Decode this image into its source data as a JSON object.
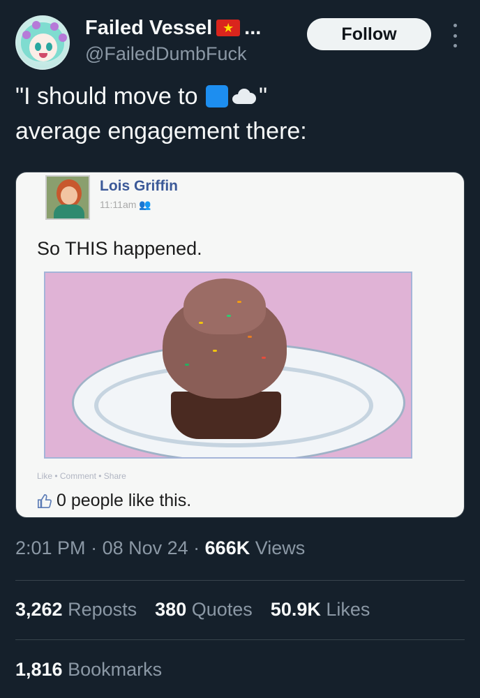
{
  "author": {
    "display_name": "Failed Vessel",
    "flag_icon": "vietnam-flag-icon",
    "truncation": "...",
    "handle": "@FailedDumbFuck"
  },
  "follow_label": "Follow",
  "tweet": {
    "line1_start": "\"I should move to ",
    "emoji1": "blue-square-emoji",
    "emoji2": "cloud-emoji",
    "line1_end": "\"",
    "line2": "average engagement there:"
  },
  "media": {
    "fb_name": "Lois Griffin",
    "fb_time": "11:11am",
    "fb_post": "So THIS happened.",
    "fb_actions": "Like • Comment • Share",
    "fb_likes": "0 people like this."
  },
  "meta": {
    "time": "2:01 PM",
    "sep": " · ",
    "date": "08 Nov 24",
    "views_count": "666K",
    "views_label": "Views"
  },
  "stats": {
    "reposts_count": "3,262",
    "reposts_label": "Reposts",
    "quotes_count": "380",
    "quotes_label": "Quotes",
    "likes_count": "50.9K",
    "likes_label": "Likes",
    "bookmarks_count": "1,816",
    "bookmarks_label": "Bookmarks"
  },
  "colors": {
    "background": "#15202b",
    "secondary_text": "#8b98a5",
    "facebook_blue": "#3b5998"
  }
}
